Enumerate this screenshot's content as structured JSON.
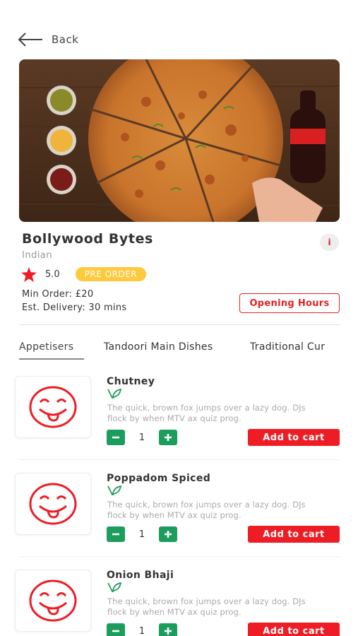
{
  "header": {
    "back_label": "Back"
  },
  "restaurant": {
    "name": "Bollywood Bytes",
    "cuisine": "Indian",
    "rating": "5.0",
    "badge": "PRE ORDER",
    "min_order": "Min Order: £20",
    "est_delivery": "Est. Delivery: 30 mins",
    "hours_button": "Opening Hours",
    "info_icon": "i"
  },
  "tabs": [
    {
      "label": "Appetisers"
    },
    {
      "label": "Tandoori Main Dishes"
    },
    {
      "label": "Traditional Cur"
    }
  ],
  "items": [
    {
      "name": "Chutney",
      "desc": "The quick, brown fox jumps over a lazy dog. DJs flock by when MTV ax quiz prog.",
      "qty": "1",
      "add_label": "Add to cart"
    },
    {
      "name": "Poppadom Spiced",
      "desc": "The quick, brown fox jumps over a lazy dog. DJs flock by when MTV ax quiz prog.",
      "qty": "1",
      "add_label": "Add to cart"
    },
    {
      "name": "Onion Bhaji",
      "desc": "The quick, brown fox jumps over a lazy dog. DJs flock by when MTV ax quiz prog.",
      "qty": "1",
      "add_label": "Add to cart"
    }
  ],
  "colors": {
    "accent_red": "#ee1c24",
    "qty_green": "#1d9d5d",
    "badge_yellow": "#ffc93c",
    "veg_green": "#1d9d5d"
  },
  "icons": {
    "back": "arrow-left-icon",
    "star": "star-icon",
    "veg": "leaf-icon",
    "placeholder": "smiley-tongue-icon",
    "minus": "minus-icon",
    "plus": "plus-icon"
  }
}
